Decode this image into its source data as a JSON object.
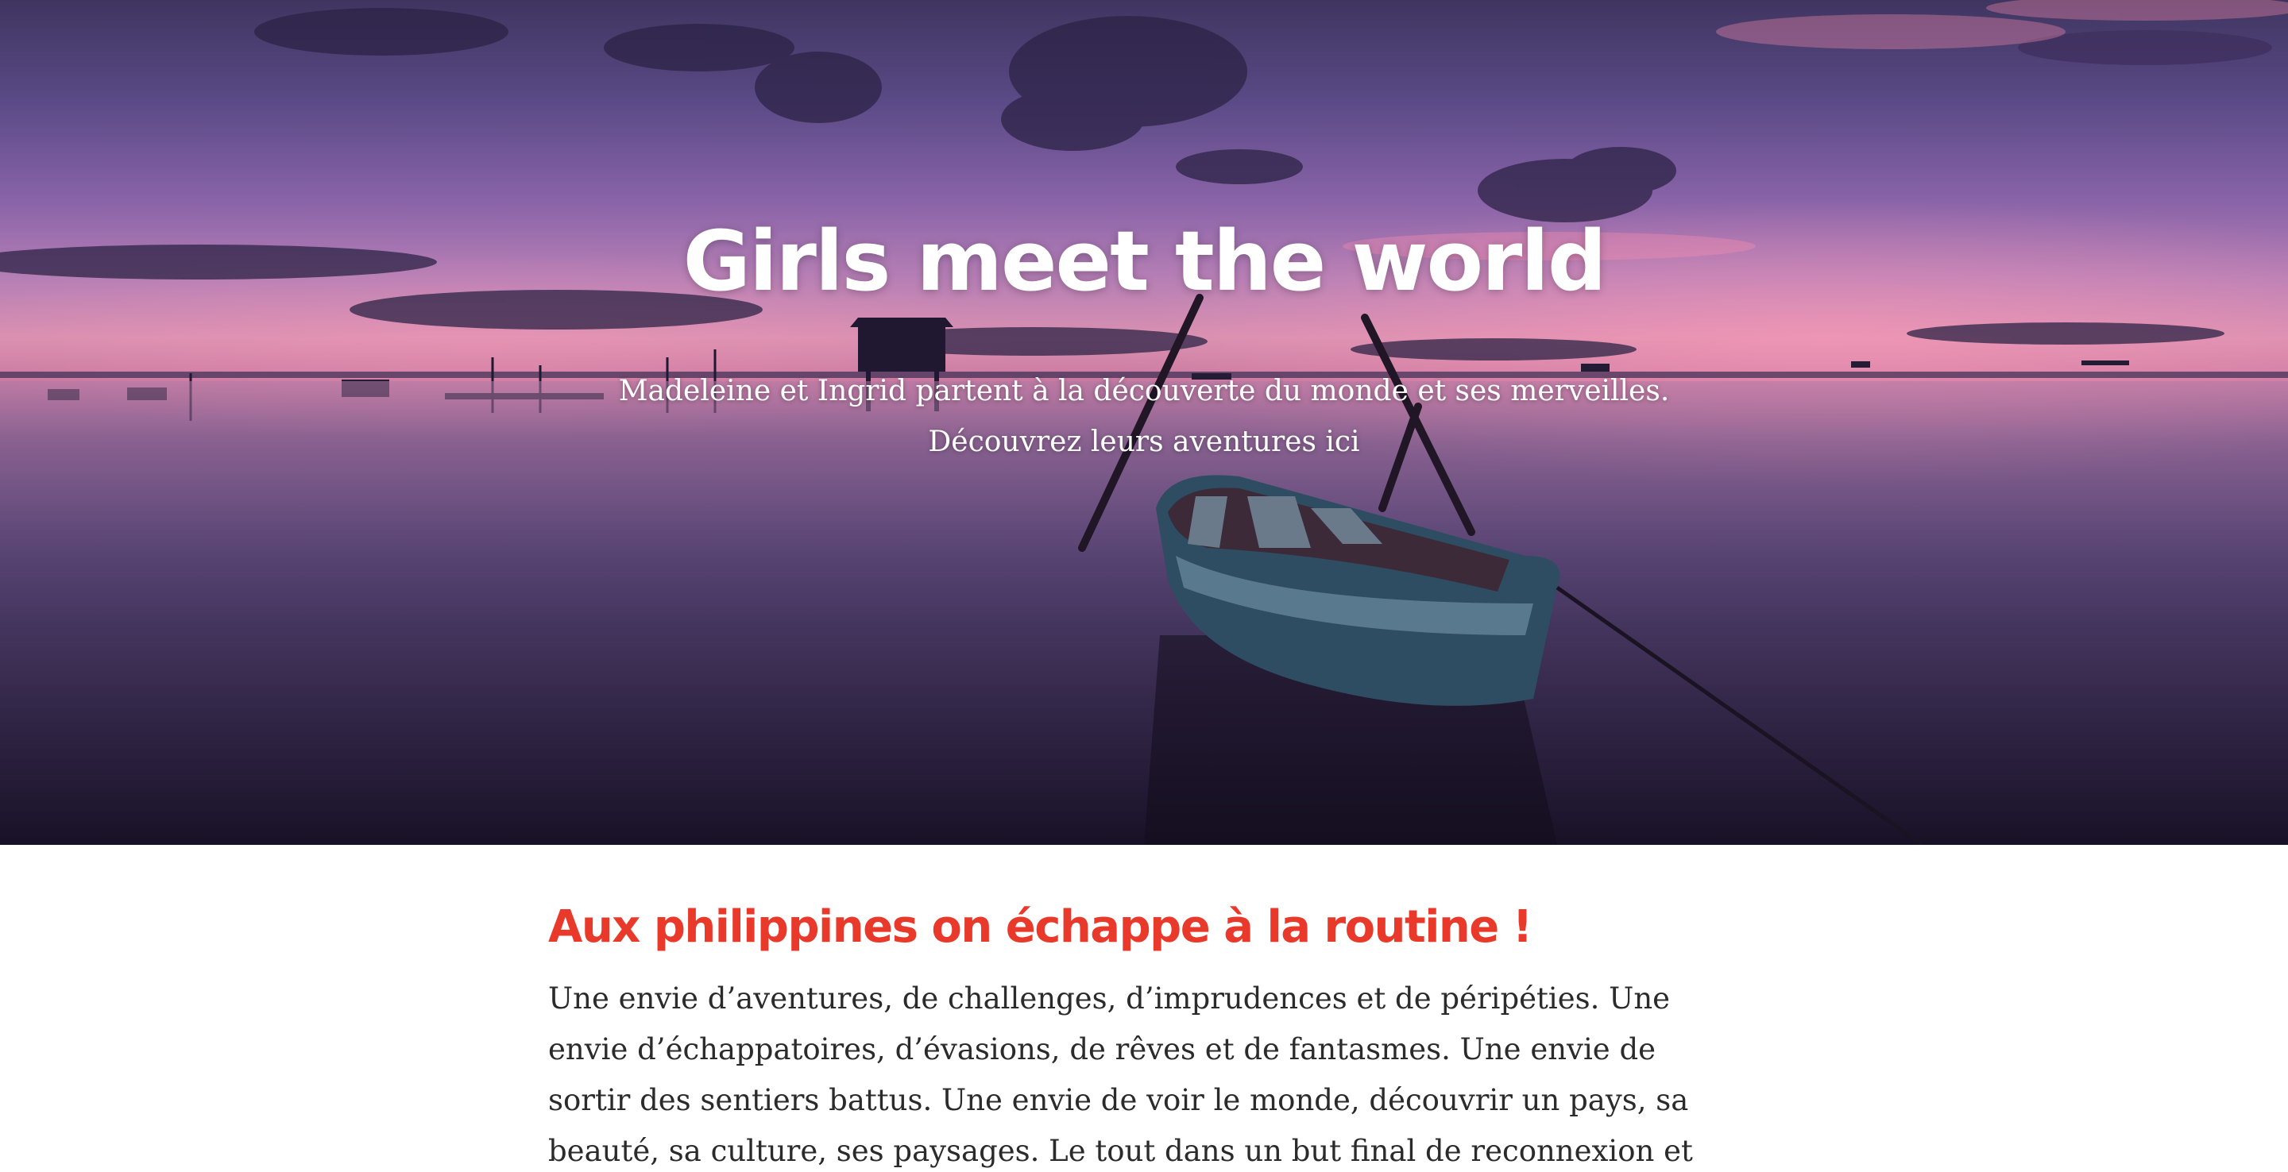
{
  "hero": {
    "title": "Girls meet the world",
    "subtitle_line1": "Madeleine et Ingrid partent à la découverte du monde et ses merveilles.",
    "subtitle_line2": "Découvrez leurs aventures ici"
  },
  "article": {
    "title": "Aux philippines on échappe à la routine !",
    "body": "Une envie d’aventures, de challenges, d’imprudences et de péripéties. Une envie d’échappatoires, d’évasions, de rêves et de fantasmes. Une envie de sortir des sentiers battus. Une envie de voir le monde, découvrir un pays, sa beauté, sa culture, ses paysages. Le tout dans un but final de reconnexion et de dépassement"
  },
  "colors": {
    "accent": "#e8392b",
    "text": "#2b2b2b",
    "hero_text": "#ffffff"
  }
}
